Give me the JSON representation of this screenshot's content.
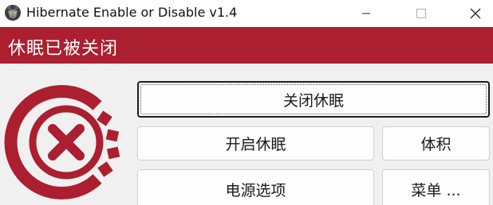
{
  "window": {
    "title": "Hibernate Enable or Disable v1.4",
    "app_icon": "wolf-icon",
    "controls": [
      "minimize-icon",
      "maximize-icon",
      "close-icon"
    ]
  },
  "banner": {
    "text": "休眠已被关闭",
    "color": "#ab1f31"
  },
  "status": {
    "icon": "disabled-x-icon",
    "color": "#ab1f31"
  },
  "buttons": {
    "disable_hibernate": "关闭休眠",
    "enable_hibernate": "开启休眠",
    "size": "体积",
    "power_options": "电源选项",
    "menu": "菜单 ..."
  }
}
